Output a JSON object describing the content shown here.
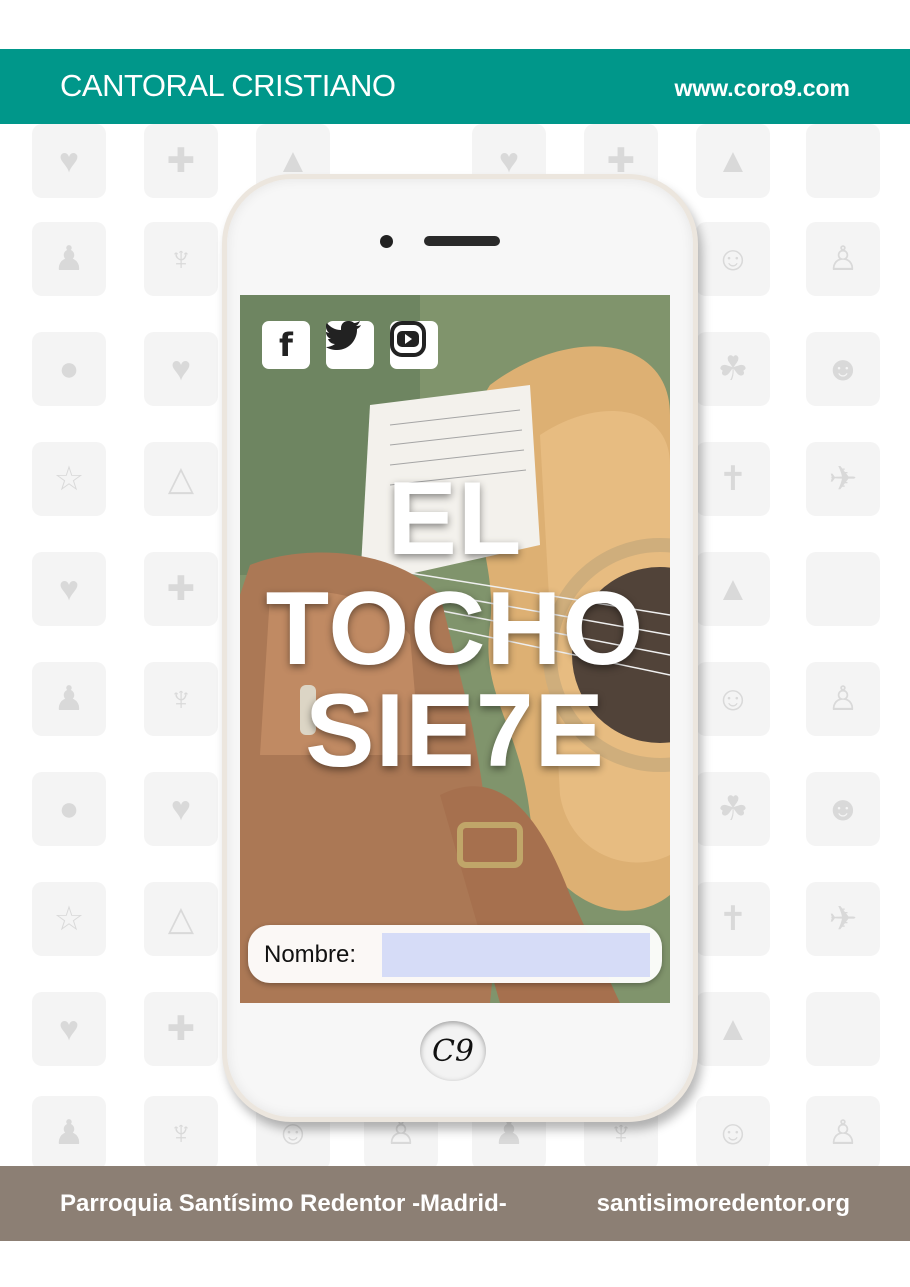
{
  "header": {
    "title": "CANTORAL CRISTIANO",
    "url": "www.coro9.com",
    "color": "#00978a"
  },
  "phone": {
    "social": {
      "facebook_glyph": "f",
      "facebook_icon": "facebook-icon",
      "twitter_icon": "twitter-icon",
      "youtube_icon": "youtube-icon"
    },
    "title_lines": [
      "EL",
      "TOCHO",
      "SIE7E"
    ],
    "name_label": "Nombre:",
    "name_value": "",
    "home_button_label": "C9"
  },
  "footer": {
    "parish": "Parroquia Santísimo Redentor -Madrid-",
    "site": "santisimoredentor.org",
    "color": "#8c7f74"
  }
}
